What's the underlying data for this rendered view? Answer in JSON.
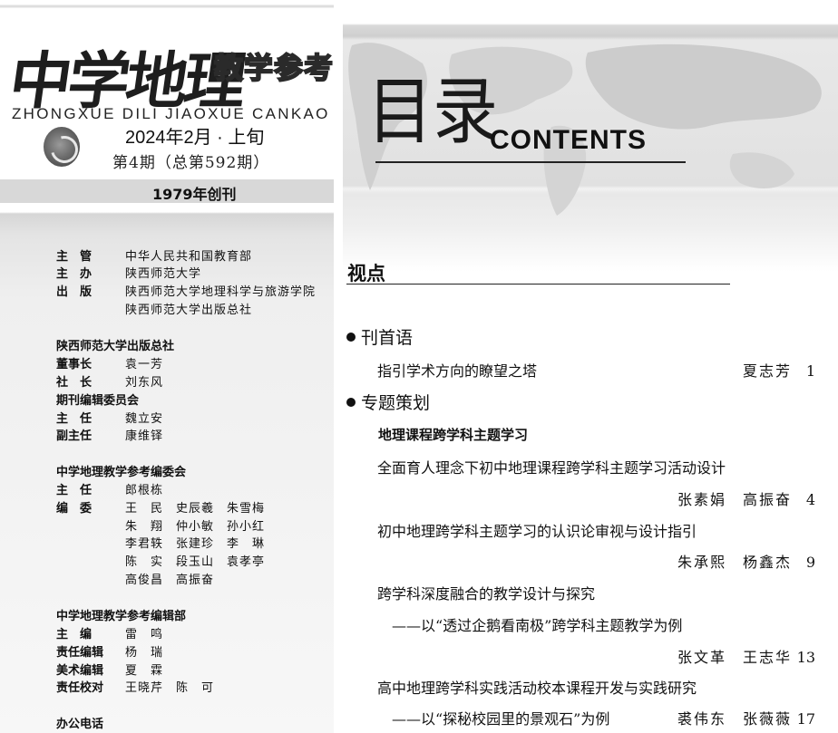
{
  "masthead": {
    "logo_text": "中学地理",
    "logo_subtitle": "教学参考",
    "pinyin": "ZHONGXUE DILI JIAOXUE CANKAO",
    "emblem_icon": "publisher-emblem-icon",
    "issue_date": "2024年2月 · 上旬",
    "issue_number": "第4期（总第592期）",
    "founded": "1979年创刊"
  },
  "credits": {
    "groups": [
      {
        "rows": [
          {
            "key": "主　管",
            "value": "中华人民共和国教育部"
          },
          {
            "key": "主　办",
            "value": "陕西师范大学"
          },
          {
            "key": "出　版",
            "value": "陕西师范大学地理科学与旅游学院"
          },
          {
            "key": "",
            "value": "陕西师范大学出版总社"
          }
        ]
      },
      {
        "title": "陕西师范大学出版总社",
        "rows": [
          {
            "key": "董事长",
            "value": "袁一芳"
          },
          {
            "key": "社　长",
            "value": "刘东风"
          }
        ]
      },
      {
        "title": "期刊编辑委员会",
        "rows": [
          {
            "key": "主　任",
            "value": "魏立安"
          },
          {
            "key": "副主任",
            "value": "康维铎"
          }
        ]
      },
      {
        "title": "中学地理教学参考编委会",
        "rows": [
          {
            "key": "主　任",
            "value": "郎根栋"
          },
          {
            "key": "编　委",
            "value": "王　民　史辰羲　朱雪梅"
          },
          {
            "key": "",
            "value": "朱　翔　仲小敏　孙小红"
          },
          {
            "key": "",
            "value": "李君轶　张建珍　李　琳"
          },
          {
            "key": "",
            "value": "陈　实　段玉山　袁孝亭"
          },
          {
            "key": "",
            "value": "高俊昌　高振奋"
          }
        ]
      },
      {
        "title": "中学地理教学参考编辑部",
        "rows": [
          {
            "key": "主　编",
            "value": "雷　鸣"
          },
          {
            "key": "责任编辑",
            "value": "杨　瑞"
          },
          {
            "key": "美术编辑",
            "value": "夏　霖"
          },
          {
            "key": "责任校对",
            "value": "王晓芹　陈　可"
          }
        ]
      },
      {
        "title": "办公电话",
        "rows": []
      }
    ]
  },
  "toc": {
    "title_cn": "目录",
    "title_en": "CONTENTS",
    "section": "视点",
    "columns": [
      {
        "label": "刊首语"
      },
      {
        "label": "专题策划"
      }
    ],
    "topic": "地理课程跨学科主题学习",
    "articles": [
      {
        "title": "指引学术方向的瞭望之塔",
        "subtitle": "",
        "authors": "夏志芳",
        "page": "1"
      },
      {
        "title": "全面育人理念下初中地理课程跨学科主题学习活动设计",
        "subtitle": "",
        "authors": "张素娟　高振奋",
        "page": "4"
      },
      {
        "title": "初中地理跨学科主题学习的认识论审视与设计指引",
        "subtitle": "",
        "authors": "朱承熙　杨鑫杰",
        "page": "9"
      },
      {
        "title": "跨学科深度融合的教学设计与探究",
        "subtitle": "——以“透过企鹅看南极”跨学科主题教学为例",
        "authors": "张文革　王志华",
        "page": "13"
      },
      {
        "title": "高中地理跨学科实践活动校本课程开发与实践研究",
        "subtitle": "——以“探秘校园里的景观石”为例",
        "authors": "裘伟东　张薇薇",
        "page": "17"
      }
    ]
  }
}
